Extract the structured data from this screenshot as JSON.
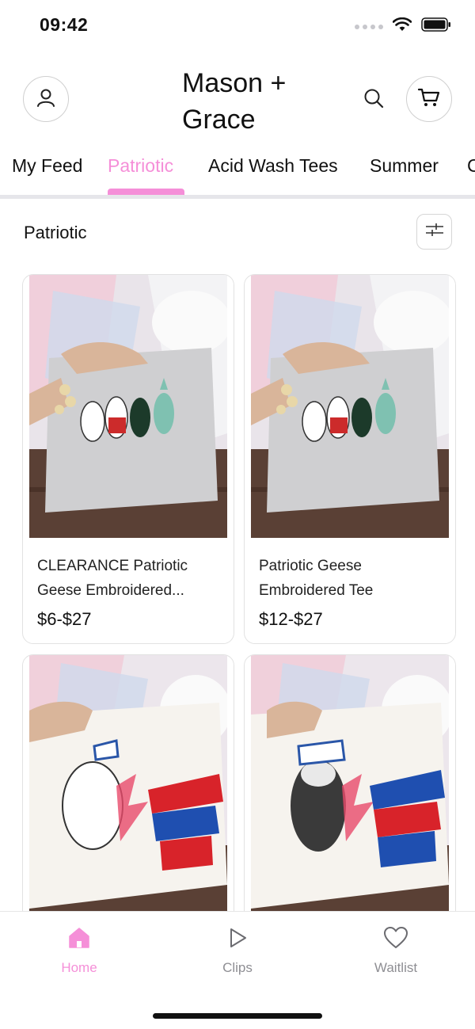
{
  "status_bar": {
    "time": "09:42",
    "icons": [
      "signal-dots-icon",
      "wifi-icon",
      "battery-icon"
    ]
  },
  "header": {
    "brand_line1": "Mason +",
    "brand_line2": "Grace",
    "icons": [
      "account-icon",
      "search-icon",
      "cart-icon"
    ]
  },
  "tabs": [
    {
      "label": "My Feed",
      "active": false
    },
    {
      "label": "Patriotic",
      "active": true
    },
    {
      "label": "Acid Wash Tees",
      "active": false
    },
    {
      "label": "Summer",
      "active": false
    },
    {
      "label": "C",
      "active": false
    }
  ],
  "section": {
    "title": "Patriotic",
    "filter_icon": "sliders-icon"
  },
  "products": [
    {
      "title": "CLEARANCE Patriotic Geese Embroidered...",
      "price": "$6-$27"
    },
    {
      "title": "Patriotic Geese Embroidered Tee",
      "price": "$12-$27"
    },
    {
      "title": "",
      "price": ""
    },
    {
      "title": "",
      "price": ""
    }
  ],
  "bottom_nav": [
    {
      "label": "Home",
      "icon": "home-icon",
      "active": true
    },
    {
      "label": "Clips",
      "icon": "play-icon",
      "active": false
    },
    {
      "label": "Waitlist",
      "icon": "heart-icon",
      "active": false
    }
  ],
  "colors": {
    "accent": "#f58fd8",
    "inactive": "#8e8e93",
    "divider": "#e6e6ea"
  }
}
